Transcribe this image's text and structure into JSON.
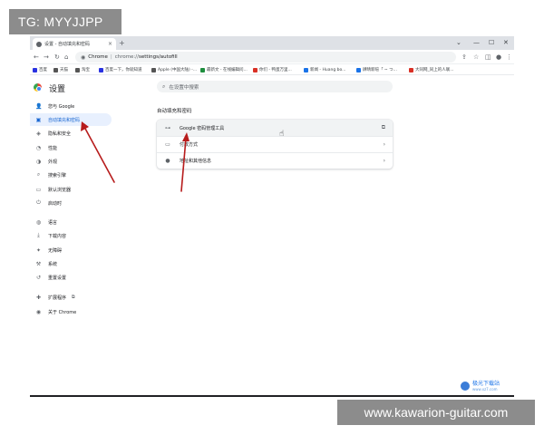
{
  "browser": {
    "tab_title": "设置 - 自动填充和密码",
    "tab_close": "×",
    "new_tab": "+",
    "window_controls": [
      "⌄",
      "—",
      "☐",
      "✕"
    ],
    "site_chip": "Chrome",
    "url_scheme": "chrome://",
    "url_path": "settings/autofill"
  },
  "bookmarks": [
    {
      "label": "百度",
      "color": "#2932e1"
    },
    {
      "label": "天猫",
      "color": "#555555"
    },
    {
      "label": "淘宝",
      "color": "#555555"
    },
    {
      "label": "百度一下，你就知道",
      "color": "#2932e1"
    },
    {
      "label": "Apple (中国大陆) -...",
      "color": "#555555"
    },
    {
      "label": "最新文 - 在线编辑问...",
      "color": "#1e8e3e"
    },
    {
      "label": "你们 - 鸭蛋万里...",
      "color": "#d93025"
    },
    {
      "label": "新闻 - Huang bo...",
      "color": "#1a73e8"
    },
    {
      "label": "肆晴新喧「 ~ つ...",
      "color": "#1a73e8"
    },
    {
      "label": "大同网_同上的人联...",
      "color": "#d93025"
    }
  ],
  "settings": {
    "title": "设置",
    "search_placeholder": "在设置中搜索",
    "sidebar": [
      {
        "label": "您与 Google",
        "icon": "person-icon",
        "glyph": "👤"
      },
      {
        "label": "自动填充和密码",
        "icon": "autofill-icon",
        "glyph": "▣",
        "active": true
      },
      {
        "label": "隐私和安全",
        "icon": "shield-icon",
        "glyph": "◈"
      },
      {
        "label": "性能",
        "icon": "speedometer-icon",
        "glyph": "◔"
      },
      {
        "label": "外观",
        "icon": "palette-icon",
        "glyph": "◑"
      },
      {
        "label": "搜索引擎",
        "icon": "search-icon",
        "glyph": "⌕"
      },
      {
        "label": "默认浏览器",
        "icon": "browser-icon",
        "glyph": "▭"
      },
      {
        "label": "启动时",
        "icon": "power-icon",
        "glyph": "⏻"
      },
      {
        "label": "语言",
        "icon": "globe-icon",
        "glyph": "◍"
      },
      {
        "label": "下载内容",
        "icon": "download-icon",
        "glyph": "⤓"
      },
      {
        "label": "无障碍",
        "icon": "accessibility-icon",
        "glyph": "✦"
      },
      {
        "label": "系统",
        "icon": "wrench-icon",
        "glyph": "⚒"
      },
      {
        "label": "重置设置",
        "icon": "reset-icon",
        "glyph": "↺"
      },
      {
        "label": "扩展程序",
        "icon": "extension-icon",
        "glyph": "✚",
        "external": "⧉"
      },
      {
        "label": "关于 Chrome",
        "icon": "chrome-icon",
        "glyph": "◉"
      }
    ],
    "section_title": "自动填充和密码",
    "rows": [
      {
        "label": "Google 密码管理工具",
        "icon": "key-icon",
        "glyph": "⊶",
        "end": "⧉",
        "end_icon": "external-link-icon"
      },
      {
        "label": "付款方式",
        "icon": "credit-card-icon",
        "glyph": "▭",
        "end": "›",
        "end_icon": "chevron-right-icon"
      },
      {
        "label": "地址和其他信息",
        "icon": "location-icon",
        "glyph": "●",
        "end": "›",
        "end_icon": "chevron-right-icon"
      }
    ]
  },
  "overlays": {
    "top_left_badge": "TG: MYYJJPP",
    "bottom_right_badge": "www.kawarion-guitar.com",
    "watermark_title": "极光下载站",
    "watermark_sub": "www.xz7.com"
  },
  "annotation_color": "#b71c1c"
}
